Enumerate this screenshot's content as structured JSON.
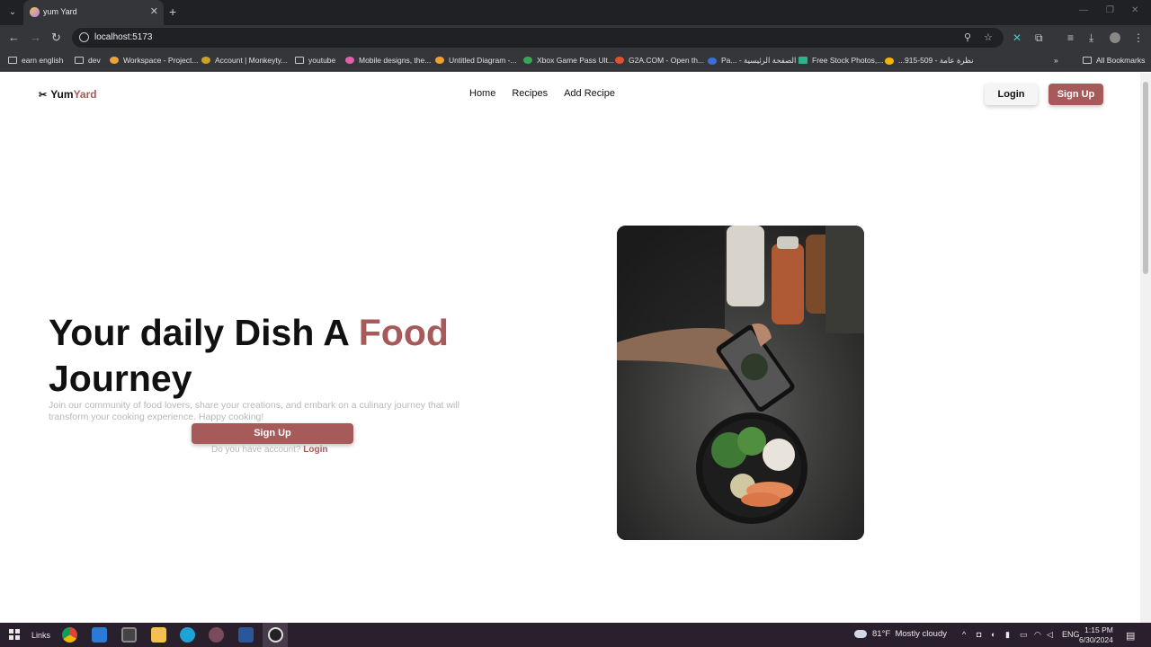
{
  "browser": {
    "tab_title": "yum Yard",
    "url": "localhost:5173",
    "bookmarks": [
      "earn english",
      "dev",
      "Workspace - Project...",
      "Account | Monkeyty...",
      "youtube",
      "Mobile designs, the...",
      "Untitled Diagram -...",
      "Xbox Game Pass Ult...",
      "G2A.COM - Open th...",
      "Pa... - الصفحة الرئيسية",
      "Free Stock Photos,...",
      "...915-509 - نظرة عامة"
    ],
    "all_bookmarks": "All Bookmarks",
    "accent": "#a65a5a"
  },
  "site": {
    "logo_main": "Yum",
    "logo_accent": "Yard",
    "nav": [
      "Home",
      "Recipes",
      "Add Recipe"
    ],
    "login_label": "Login",
    "signup_label": "Sign Up"
  },
  "hero": {
    "title_part1": "Your daily Dish A ",
    "title_accent": "Food",
    "title_part2": "Journey",
    "description": "Join our community of food lovers, share your creations, and embark on a culinary journey that will transform your cooking experience. Happy cooking!",
    "cta_label": "Sign Up",
    "account_question": "Do you have account? ",
    "login_link": "Login"
  },
  "taskbar": {
    "links_label": "Links",
    "weather_temp": "81°F",
    "weather_desc": "Mostly cloudy",
    "language": "ENG",
    "time": "1:15 PM",
    "date": "6/30/2024"
  }
}
